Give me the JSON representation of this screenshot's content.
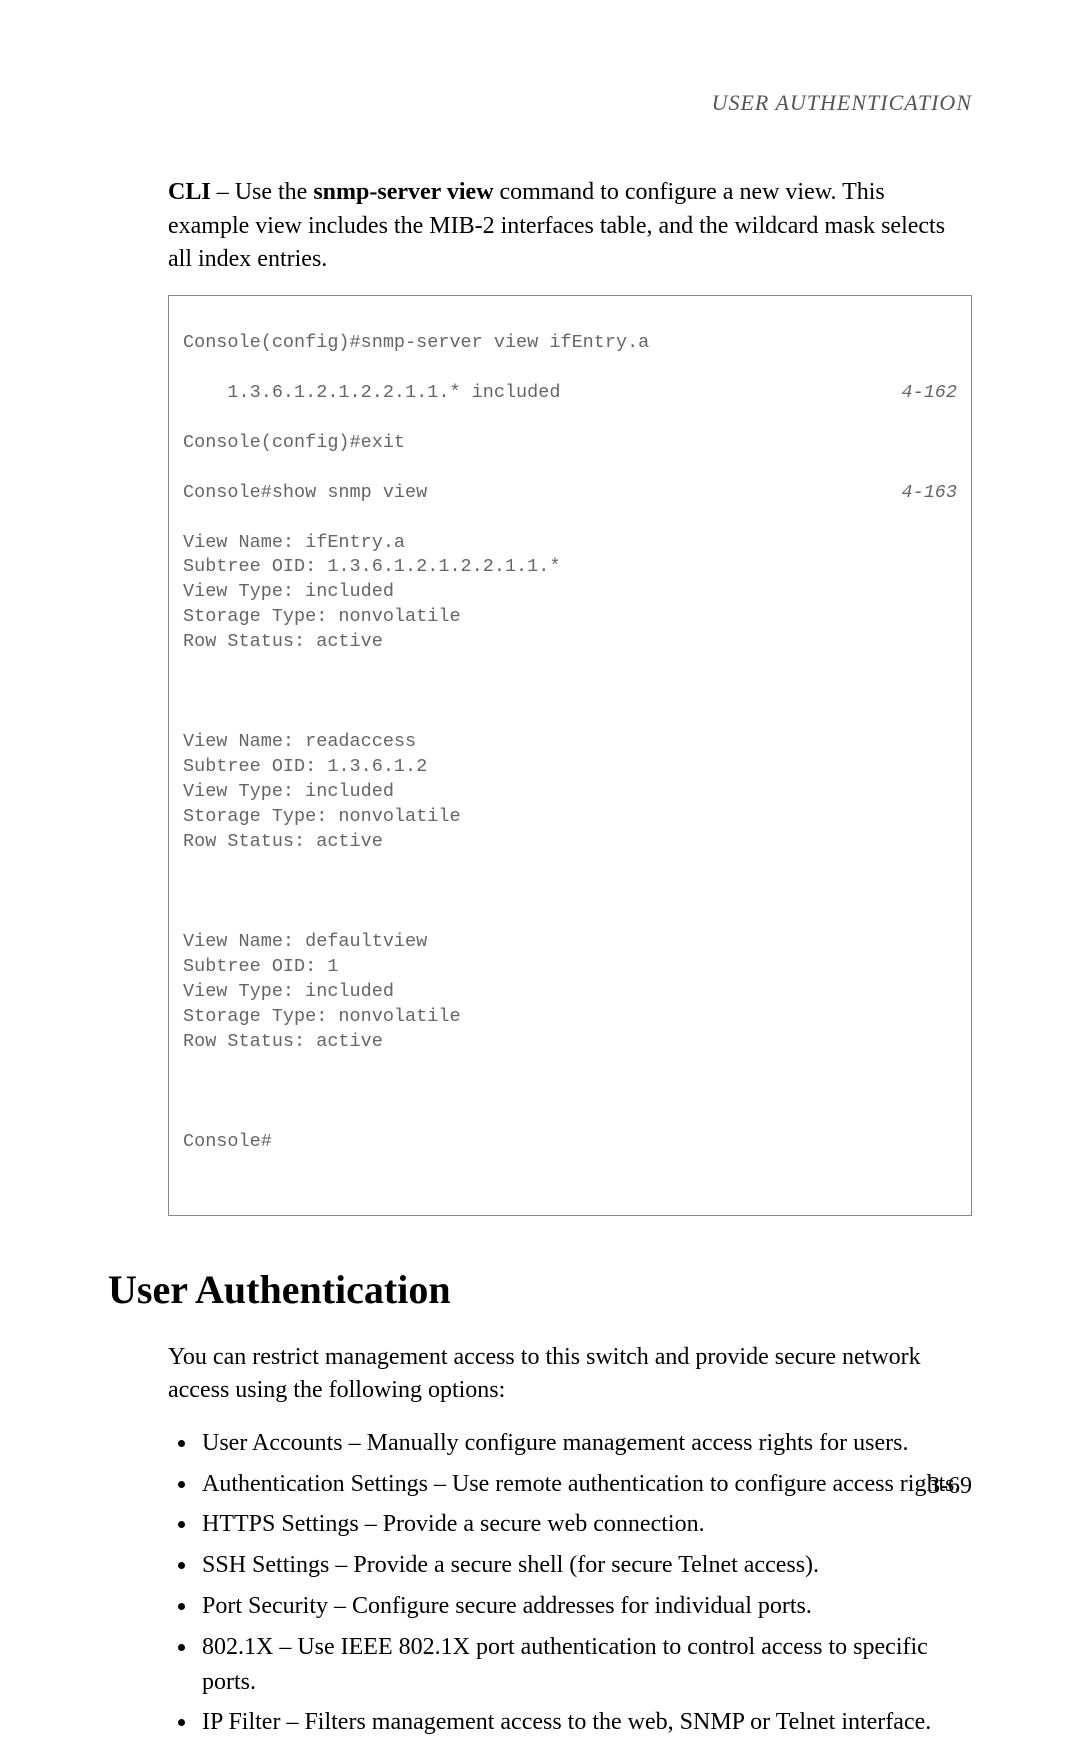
{
  "running_head": "USER AUTHENTICATION",
  "intro": {
    "cli_label": "CLI",
    "intro_prefix": " – Use the ",
    "cmd": "snmp-server view",
    "intro_suffix": " command to configure a new view. This example view includes the MIB-2 interfaces table, and the wildcard mask selects all index entries."
  },
  "code": {
    "line1_left": "Console(config)#snmp-server view ifEntry.a",
    "line2_left": "    1.3.6.1.2.1.2.2.1.1.* included",
    "line2_right": "4-162",
    "line3": "Console(config)#exit",
    "line4_left": "Console#show snmp view",
    "line4_right": "4-163",
    "block1": "View Name: ifEntry.a\nSubtree OID: 1.3.6.1.2.1.2.2.1.1.*\nView Type: included\nStorage Type: nonvolatile\nRow Status: active",
    "block2": "View Name: readaccess\nSubtree OID: 1.3.6.1.2\nView Type: included\nStorage Type: nonvolatile\nRow Status: active",
    "block3": "View Name: defaultview\nSubtree OID: 1\nView Type: included\nStorage Type: nonvolatile\nRow Status: active",
    "end": "Console#"
  },
  "heading": "User Authentication",
  "para": "You can restrict management access to this switch and provide secure network access using the following options:",
  "bullets": [
    "User Accounts – Manually configure management access rights for users.",
    "Authentication Settings – Use remote authentication to configure access rights.",
    "HTTPS Settings – Provide a secure web connection.",
    "SSH Settings – Provide a secure shell (for secure Telnet access).",
    "Port Security – Configure secure addresses for individual ports.",
    "802.1X – Use IEEE 802.1X port authentication to control access to specific ports.",
    "IP Filter – Filters management access to the web, SNMP or Telnet interface."
  ],
  "page_number": "3-69"
}
